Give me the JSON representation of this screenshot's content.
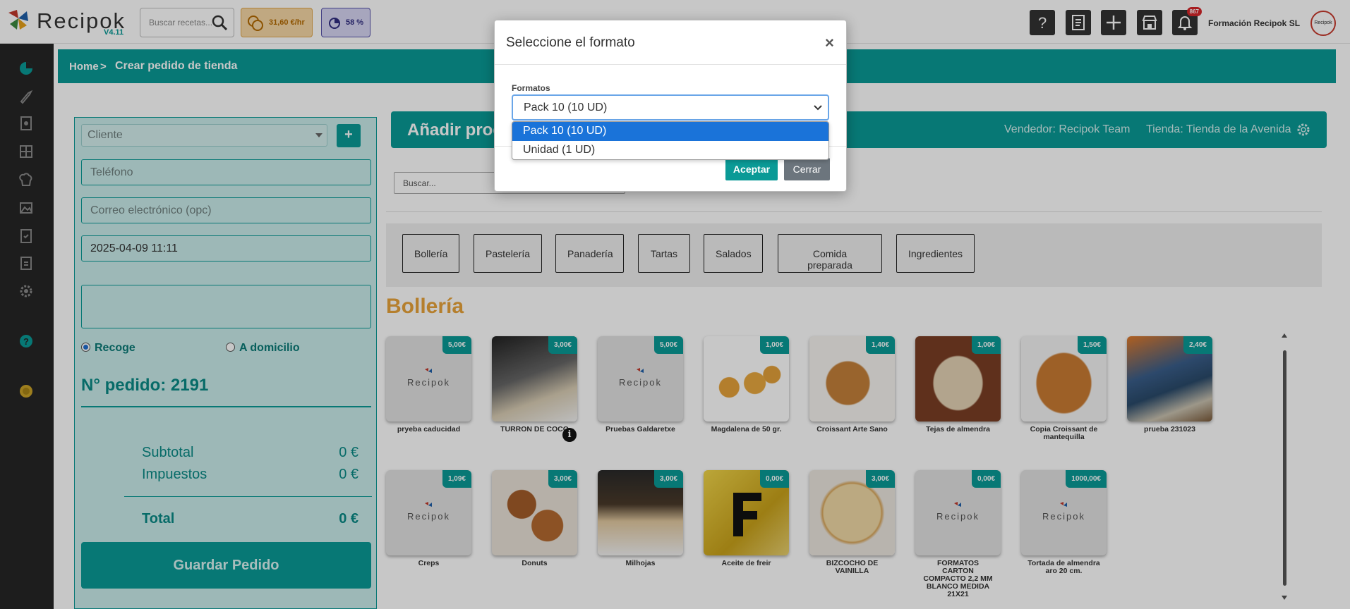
{
  "app": {
    "name": "Recipok",
    "version": "V4.11",
    "search_placeholder": "Buscar recetas...",
    "rate": "31,60 €/hr",
    "percent": "58 %",
    "notification_count": "867",
    "company": "Formación Recipok SL",
    "avatar_text": "Recipok",
    "colors": {
      "primary": "#0a9a96",
      "accent": "#e8a33a",
      "sidebar": "#262626"
    }
  },
  "toolbar_icons": [
    "help-icon",
    "document-icon",
    "add-icon",
    "store-icon",
    "bell-icon"
  ],
  "sidebar_icons": [
    "dashboard-icon",
    "recipe-icon",
    "book-icon",
    "layout-icon",
    "chef-hat-icon",
    "gallery-icon",
    "checklist-icon",
    "clipboard-icon",
    "settings-icon",
    "help-circle-icon",
    "coin-icon"
  ],
  "breadcrumb": {
    "home": "Home",
    "separator": ">",
    "current": "Crear pedido de tienda"
  },
  "order_form": {
    "client_placeholder": "Cliente",
    "add_button": "+",
    "phone_placeholder": "Teléfono",
    "email_placeholder": "Correo electrónico (opc)",
    "datetime": "2025-04-09 11:11",
    "pickup_label": "Recoge",
    "delivery_label": "A domicilio",
    "order_number": "N° pedido: 2191",
    "subtotal_label": "Subtotal",
    "subtotal_value": "0 €",
    "taxes_label": "Impuestos",
    "taxes_value": "0 €",
    "total_label": "Total",
    "total_value": "0 €",
    "save_button": "Guardar Pedido"
  },
  "products_header": {
    "title": "Añadir productos",
    "seller": "Vendedor: Recipok Team",
    "store": "Tienda: Tienda de la Avenida"
  },
  "product_search_placeholder": "Buscar...",
  "categories": [
    "Bollería",
    "Pastelería",
    "Panadería",
    "Tartas",
    "Salados",
    "Comida preparada",
    "Ingredientes"
  ],
  "section_title": "Bollería",
  "products": [
    {
      "name": "pryeba caducidad",
      "price": "5,00€",
      "image": "placeholder"
    },
    {
      "name": "TURRON DE COCO",
      "price": "3,00€",
      "image": "jar-photo"
    },
    {
      "name": "Pruebas Galdaretxe",
      "price": "5,00€",
      "image": "placeholder"
    },
    {
      "name": "Magdalena de 50 gr.",
      "price": "1,00€",
      "image": "muffins-photo"
    },
    {
      "name": "Croissant Arte Sano",
      "price": "1,40€",
      "image": "croissant-photo"
    },
    {
      "name": "Tejas de almendra",
      "price": "1,00€",
      "image": "tejas-photo"
    },
    {
      "name": "Copia Croissant de mantequilla",
      "price": "1,50€",
      "image": "croissant-photo"
    },
    {
      "name": "prueba 231023",
      "price": "2,40€",
      "image": "painting-photo"
    },
    {
      "name": "Creps",
      "price": "1,09€",
      "image": "placeholder"
    },
    {
      "name": "Donuts",
      "price": "3,00€",
      "image": "donuts-photo"
    },
    {
      "name": "Milhojas",
      "price": "3,00€",
      "image": "pastries-photo"
    },
    {
      "name": "Aceite de freir",
      "price": "0,00€",
      "image": "letter-f-photo"
    },
    {
      "name": "BIZCOCHO DE VAINILLA",
      "price": "3,00€",
      "image": "sponge-cake-photo"
    },
    {
      "name": "FORMATOS CARTON COMPACTO 2,2 MM BLANCO MEDIDA 21X21",
      "price": "0,00€",
      "image": "placeholder"
    },
    {
      "name": "Tortada de almendra aro 20 cm.",
      "price": "1000,00€",
      "image": "placeholder"
    }
  ],
  "placeholder_logo": "Recipok",
  "modal": {
    "title": "Seleccione el formato",
    "close_symbol": "×",
    "field_label": "Formatos",
    "selected": "Pack 10 (10 UD)",
    "options": [
      "Pack 10 (10 UD)",
      "Unidad (1 UD)"
    ],
    "accept_button": "Aceptar",
    "close_button": "Cerrar"
  }
}
